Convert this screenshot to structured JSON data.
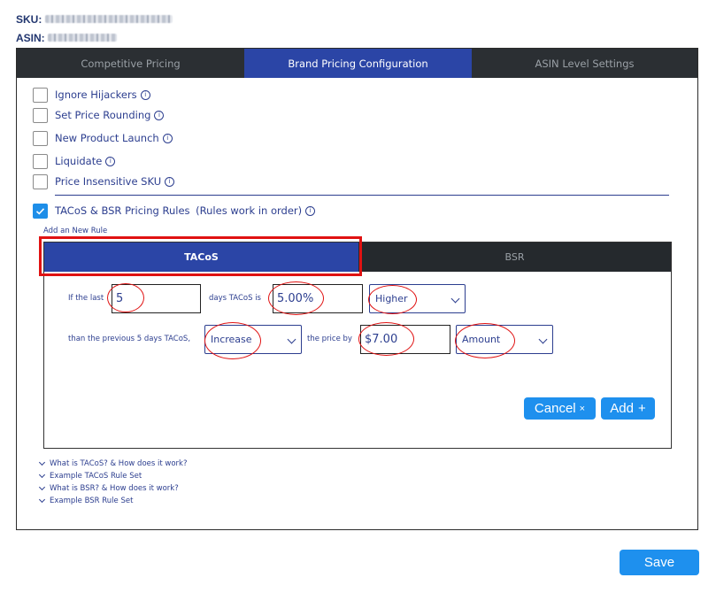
{
  "header": {
    "sku_label": "SKU:",
    "asin_label": "ASIN:"
  },
  "tabs": [
    {
      "label": "Competitive Pricing",
      "active": false
    },
    {
      "label": "Brand Pricing Configuration",
      "active": true
    },
    {
      "label": "ASIN Level Settings",
      "active": false
    }
  ],
  "options": [
    {
      "label": "Ignore Hijackers",
      "checked": false
    },
    {
      "label": "Set Price Rounding",
      "checked": false
    },
    {
      "label": "New Product Launch",
      "checked": false
    },
    {
      "label": "Liquidate",
      "checked": false
    },
    {
      "label": "Price Insensitive SKU",
      "checked": false
    }
  ],
  "tacos_bsr": {
    "label": "TACoS & BSR Pricing Rules",
    "note": "(Rules work in order)",
    "checked": true
  },
  "add_rule_label": "Add an New Rule",
  "rule_tabs": [
    {
      "label": "TACoS",
      "active": true
    },
    {
      "label": "BSR",
      "active": false
    }
  ],
  "rule": {
    "if_last": "If the last",
    "days_value": "5",
    "days_tacos_is": "days TACoS is",
    "tacos_value": "5.00%",
    "comparison": "Higher",
    "than_previous": "than the previous 5 days TACoS,",
    "action": "Increase",
    "price_by": "the price by",
    "amount_value": "$7.00",
    "amount_type": "Amount"
  },
  "buttons": {
    "cancel": "Cancel",
    "cancel_icon": "×",
    "add": "Add",
    "add_icon": "+",
    "save": "Save"
  },
  "help_links": [
    "What is TACoS? & How does it work?",
    "Example TACoS Rule Set",
    "What is BSR? & How does it work?",
    "Example BSR Rule Set"
  ],
  "info_icon": "i",
  "colors": {
    "accent": "#2b45a6",
    "button": "#1e90ee",
    "annotation": "#e01212",
    "tabbar": "#2b2f33"
  }
}
